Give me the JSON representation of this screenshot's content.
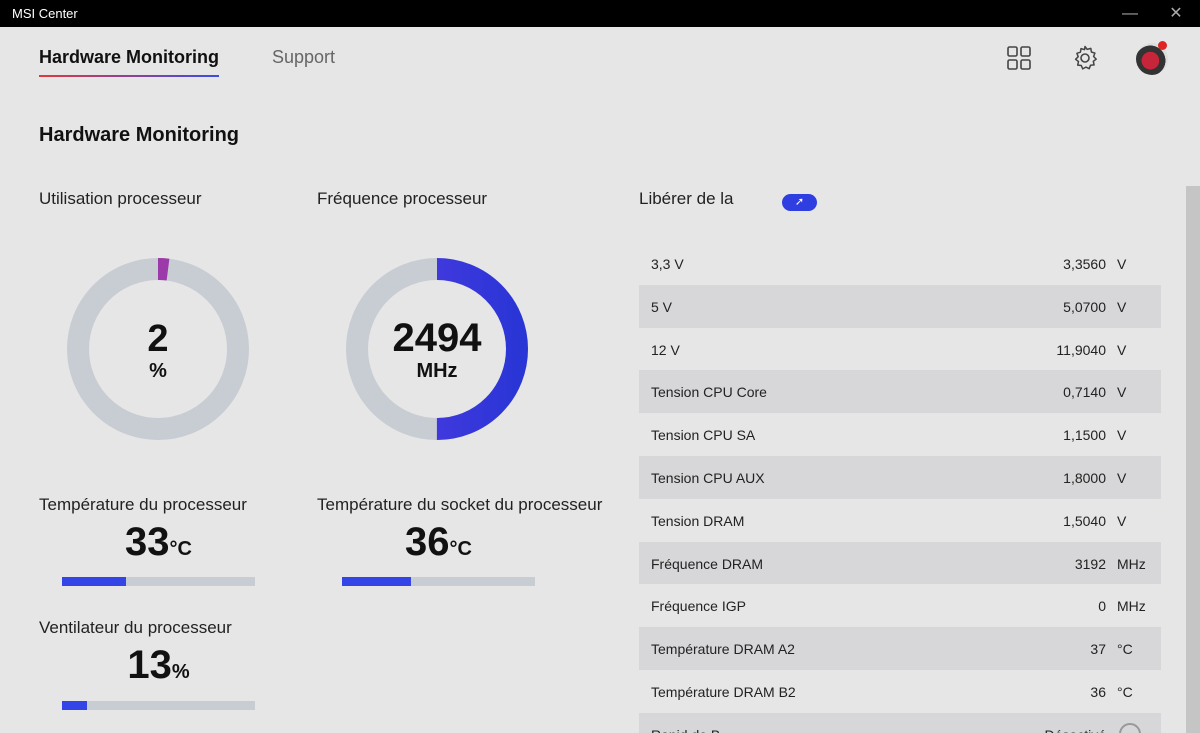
{
  "window": {
    "title": "MSI Center",
    "minimize": "—",
    "close": "✕"
  },
  "nav": {
    "tabs": [
      {
        "label": "Hardware Monitoring"
      },
      {
        "label": "Support"
      }
    ],
    "icons": {
      "apps": "apps-grid-icon",
      "settings": "gear-icon"
    }
  },
  "page": {
    "title": "Hardware Monitoring"
  },
  "cpu_usage": {
    "label": "Utilisation processeur",
    "value": "2",
    "unit": "%",
    "fraction": 0.02
  },
  "cpu_freq": {
    "label": "Fréquence processeur",
    "value": "2494",
    "unit": "MHz",
    "fraction": 0.5
  },
  "cpu_temp": {
    "label": "Température du processeur",
    "value": "33",
    "unit": "°C",
    "fraction": 0.33
  },
  "socket_temp": {
    "label": "Température du socket du processeur",
    "value": "36",
    "unit": "°C",
    "fraction": 0.36
  },
  "cpu_fan": {
    "label": "Ventilateur du processeur",
    "value": "13",
    "unit": "%",
    "fraction": 0.13
  },
  "voltage_panel": {
    "header": "Libérer de la",
    "toggle_icon": "arrow-up-icon"
  },
  "sensors": [
    {
      "label": "3,3 V",
      "value": "3,3560",
      "unit": "V"
    },
    {
      "label": "5 V",
      "value": "5,0700",
      "unit": "V"
    },
    {
      "label": "12 V",
      "value": "11,9040",
      "unit": "V"
    },
    {
      "label": "Tension CPU Core",
      "value": "0,7140",
      "unit": "V"
    },
    {
      "label": "Tension CPU SA",
      "value": "1,1500",
      "unit": "V"
    },
    {
      "label": "Tension CPU AUX",
      "value": "1,8000",
      "unit": "V"
    },
    {
      "label": "Tension DRAM",
      "value": "1,5040",
      "unit": "V"
    },
    {
      "label": "Fréquence DRAM",
      "value": "3192",
      "unit": "MHz"
    },
    {
      "label": "Fréquence IGP",
      "value": "0",
      "unit": "MHz"
    },
    {
      "label": "Température DRAM A2",
      "value": "37",
      "unit": "°C"
    },
    {
      "label": "Température DRAM B2",
      "value": "36",
      "unit": "°C"
    },
    {
      "label": "Rapid de B...",
      "value": "Désactivé",
      "unit": ""
    }
  ],
  "colors": {
    "accent": "#3345e6",
    "track": "#c8ccd3",
    "gauge_start": "#9b3aa8",
    "gauge_end": "#2a35d6"
  }
}
